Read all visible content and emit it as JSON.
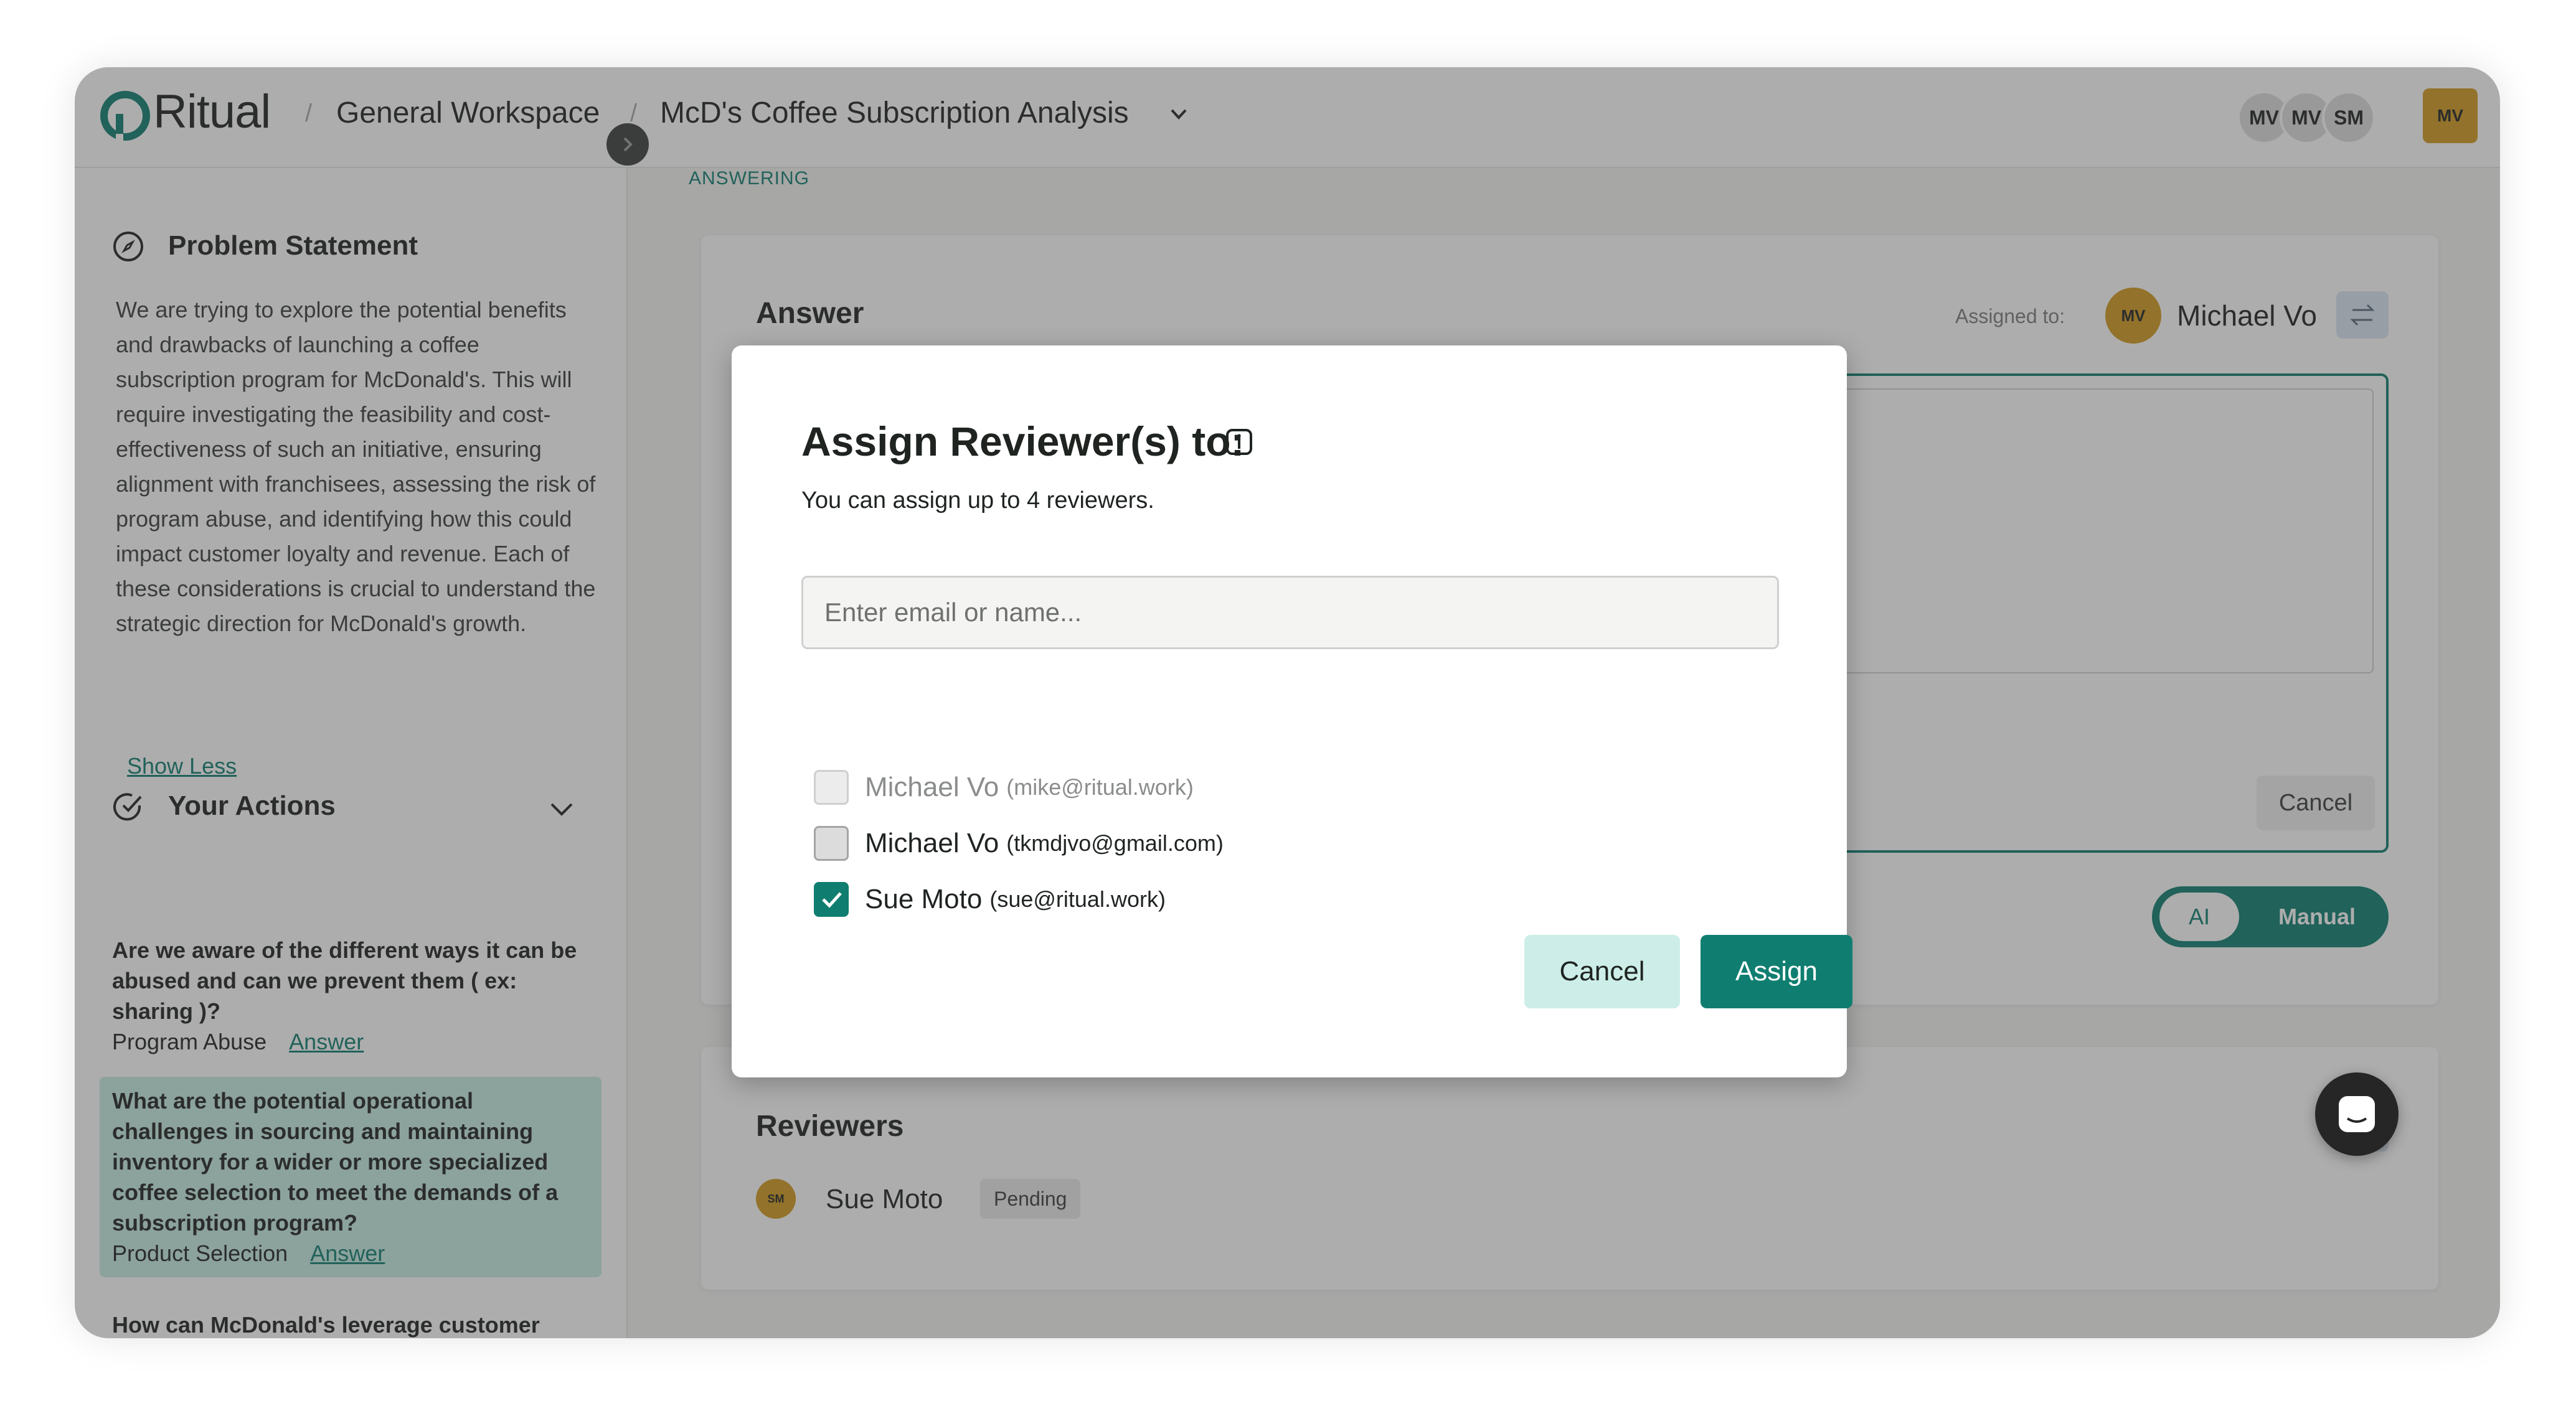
{
  "header": {
    "logo_text": "Ritual",
    "workspace": "General Workspace",
    "project": "McD's Coffee Subscription Analysis",
    "breadcrumb_separator": "/",
    "collaborators": [
      "MV",
      "MV",
      "SM"
    ],
    "user_initials": "MV"
  },
  "sidebar": {
    "problem_title": "Problem Statement",
    "problem_text": "We are trying to explore the potential benefits and drawbacks of launching a coffee subscription program for McDonald's. This will require investigating the feasibility and cost-effectiveness of such an initiative, ensuring alignment with franchisees, assessing the risk of program abuse, and identifying how this could impact customer loyalty and revenue. Each of these considerations is crucial to understand the strategic direction for McDonald's growth.",
    "show_less": "Show Less",
    "actions_title": "Your Actions",
    "actions": [
      {
        "question": "Are we aware of the different ways it can be abused and can we prevent them ( ex: sharing )?",
        "category": "Program Abuse",
        "link": "Answer"
      },
      {
        "question": "What are the potential operational challenges in sourcing and maintaining inventory for a wider or more specialized coffee selection to meet the demands of a subscription program?",
        "category": "Product Selection",
        "link": "Answer"
      },
      {
        "question": "How can McDonald's leverage customer feedback on coffee preferences to optimize its coffee selection for the",
        "category": "",
        "link": ""
      }
    ]
  },
  "main": {
    "status": "ANSWERING",
    "answer_title": "Answer",
    "assigned_label": "Assigned to:",
    "assigned_initials": "MV",
    "assigned_name": "Michael Vo",
    "cancel_label": "Cancel",
    "toggle": {
      "ai": "AI",
      "manual": "Manual"
    },
    "reviewers_title": "Reviewers",
    "reviewer": {
      "initials": "SM",
      "name": "Sue Moto",
      "status": "Pending"
    }
  },
  "modal": {
    "title": "Assign Reviewer(s) to:",
    "subtitle": "You can assign up to 4 reviewers.",
    "search_placeholder": "Enter email or name...",
    "candidates": [
      {
        "name": "Michael Vo",
        "email": "(mike@ritual.work)",
        "checked": false,
        "disabled": true
      },
      {
        "name": "Michael Vo",
        "email": "(tkmdjvo@gmail.com)",
        "checked": false,
        "disabled": false
      },
      {
        "name": "Sue Moto",
        "email": "(sue@ritual.work)",
        "checked": true,
        "disabled": false
      }
    ],
    "cancel": "Cancel",
    "assign": "Assign"
  },
  "colors": {
    "brand": "#0f7e70",
    "avatar": "#d39a20",
    "overlay": "rgba(60,60,60,0.42)"
  },
  "icons": [
    "ritual-logo-icon",
    "compass-icon",
    "check-circle-icon",
    "chevron-down-icon",
    "chevron-right-icon",
    "swap-icon",
    "info-icon",
    "check-icon",
    "chat-icon"
  ]
}
